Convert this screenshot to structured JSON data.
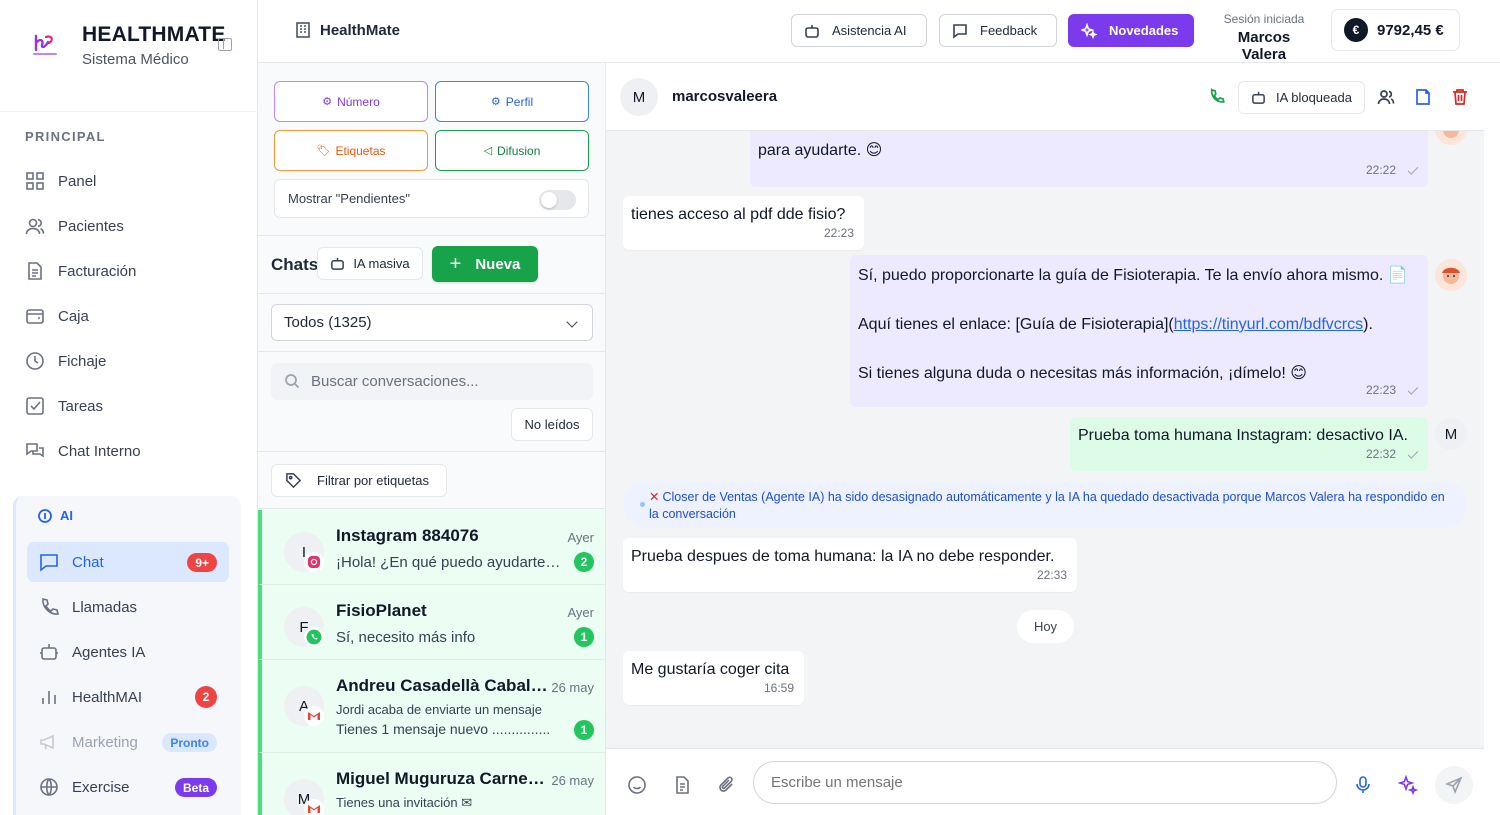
{
  "brand": {
    "name": "HEALTHMATE",
    "subtitle": "Sistema Médico"
  },
  "sidebar": {
    "section": "PRINCIPAL",
    "items": [
      {
        "label": "Panel",
        "icon": "grid-icon"
      },
      {
        "label": "Pacientes",
        "icon": "users-icon"
      },
      {
        "label": "Facturación",
        "icon": "file-icon"
      },
      {
        "label": "Caja",
        "icon": "wallet-icon"
      },
      {
        "label": "Fichaje",
        "icon": "clock-icon"
      },
      {
        "label": "Tareas",
        "icon": "checkbox-icon"
      },
      {
        "label": "Chat Interno",
        "icon": "chat-bubbles-icon"
      }
    ],
    "ai": {
      "title": "AI",
      "items": [
        {
          "label": "Chat",
          "badge": "9+",
          "active": true
        },
        {
          "label": "Llamadas"
        },
        {
          "label": "Agentes IA"
        },
        {
          "label": "HealthMAI",
          "badge": "2"
        },
        {
          "label": "Marketing",
          "badge": "Pronto",
          "disabled": true
        },
        {
          "label": "Exercise",
          "badge": "Beta"
        }
      ]
    }
  },
  "topbar": {
    "title": "HealthMate",
    "btn_ai": "Asistencia AI",
    "btn_feedback": "Feedback",
    "btn_news": "Novedades",
    "session_label": "Sesión iniciada",
    "session_user": "Marcos Valera",
    "currency_symbol": "€",
    "balance": "9792,45 €"
  },
  "panel": {
    "btn_number": "Número",
    "btn_profile": "Perfil",
    "btn_tags": "Etiquetas",
    "btn_broadcast": "Difusion",
    "toggle_label": "Mostrar \"Pendientes\"",
    "chats_label": "Chats",
    "btn_mass_ai": "IA masiva",
    "btn_new": "Nueva",
    "filter_selected": "Todos (1325)",
    "search_placeholder": "Buscar conversaciones...",
    "btn_unread": "No leídos",
    "btn_tag_filter": "Filtrar por etiquetas",
    "conversations": [
      {
        "initial": "I",
        "name": "Instagram 884076",
        "time": "Ayer",
        "preview": "¡Hola! ¿En qué puedo ayudarte h...",
        "count": "2",
        "source": "instagram"
      },
      {
        "initial": "F",
        "name": "FisioPlanet",
        "time": "Ayer",
        "preview": "Sí, necesito más info",
        "count": "1",
        "source": "whatsapp"
      },
      {
        "initial": "A",
        "name": "Andreu Casadellà Caballer...",
        "time": "26 may",
        "preview": "Jordi acaba de enviarte un mensaje",
        "preview2": "Tienes 1 mensaje nuevo ...............",
        "count": "1",
        "source": "gmail"
      },
      {
        "initial": "M",
        "name": "Miguel Muguruza Carneva...",
        "time": "26 may",
        "preview": "Tienes una invitación ✉",
        "source": "gmail"
      }
    ]
  },
  "chat": {
    "contact_initial": "M",
    "contact_name": "marcosvaleera",
    "btn_ai_blocked": "IA bloqueada",
    "messages": {
      "m0_text": "para ayudarte. 😊",
      "m0_time": "22:22",
      "m1_text": "tienes acceso al pdf dde fisio?",
      "m1_time": "22:23",
      "m2_p1": "Sí, puedo proporcionarte la guía de Fisioterapia. Te la envío ahora mismo. 📄",
      "m2_p2a": "Aquí tienes el enlace: [Guía de Fisioterapia](",
      "m2_link": "https://tinyurl.com/bdfvcrcs",
      "m2_p2b": ").",
      "m2_p3": "Si tienes alguna duda o necesitas más información, ¡dímelo! 😊",
      "m2_time": "22:23",
      "m3_text": "Prueba toma humana Instagram: desactivo IA.",
      "m3_time": "22:32",
      "m3_initial": "M",
      "system_x": "✕",
      "system_text": "Closer de Ventas (Agente IA) ha sido desasignado automáticamente y la IA ha quedado desactivada porque Marcos Valera ha respondido en la conversación",
      "m4_text": "Prueba despues de toma humana: la IA no debe responder.",
      "m4_time": "22:33",
      "day_sep": "Hoy",
      "m5_text": "Me gustaría coger cita",
      "m5_time": "16:59"
    },
    "composer_placeholder": "Escribe un mensaje"
  }
}
